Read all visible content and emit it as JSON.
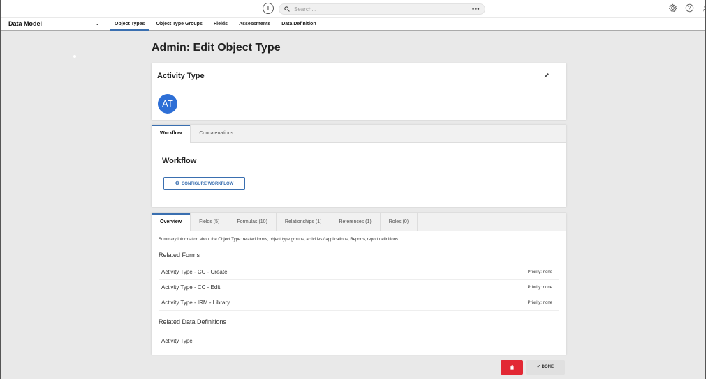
{
  "topbar": {
    "add_glyph": "+",
    "search_placeholder": "Search...",
    "search_more": "•••"
  },
  "icons": {
    "add": "plus-circle-icon",
    "search": "search-icon",
    "settings": "gear-icon",
    "help": "help-circle-icon",
    "user": "user-icon",
    "edit": "pencil-icon",
    "configure": "gear-icon",
    "delete": "trash-icon",
    "done": "check-icon"
  },
  "nav": {
    "title": "Data Model",
    "chevron": "⌄",
    "tabs": [
      {
        "label": "Object Types",
        "active": true
      },
      {
        "label": "Object Type Groups",
        "active": false
      },
      {
        "label": "Fields",
        "active": false
      },
      {
        "label": "Assessments",
        "active": false
      },
      {
        "label": "Data Definition",
        "active": false
      }
    ]
  },
  "page": {
    "title": "Admin: Edit Object Type"
  },
  "object": {
    "name": "Activity Type",
    "avatar_initials": "AT"
  },
  "workflow_card": {
    "tabs": [
      "Workflow",
      "Concatenations"
    ],
    "heading": "Workflow",
    "button_label": "CONFIGURE WORKFLOW"
  },
  "overview_card": {
    "tabs": [
      "Overview",
      "Fields (5)",
      "Formulas (10)",
      "Relationships (1)",
      "References (1)",
      "Roles (0)"
    ],
    "summary": "Summary information about the Object Type: related forms, object type groups, activities / applications, Reports, report definitions...",
    "related_forms_heading": "Related Forms",
    "forms": [
      {
        "name": "Activity Type - CC - Create",
        "priority": "Priority: none"
      },
      {
        "name": "Activity Type - CC - Edit",
        "priority": "Priority: none"
      },
      {
        "name": "Activity Type - IRM - Library",
        "priority": "Priority: none"
      }
    ],
    "related_dd_heading": "Related Data Definitions",
    "data_definitions": [
      "Activity Type"
    ]
  },
  "actions": {
    "done_label": "DONE"
  },
  "colors": {
    "accent": "#3a6fb0",
    "avatar": "#2e6fd6",
    "delete": "#e22834"
  }
}
